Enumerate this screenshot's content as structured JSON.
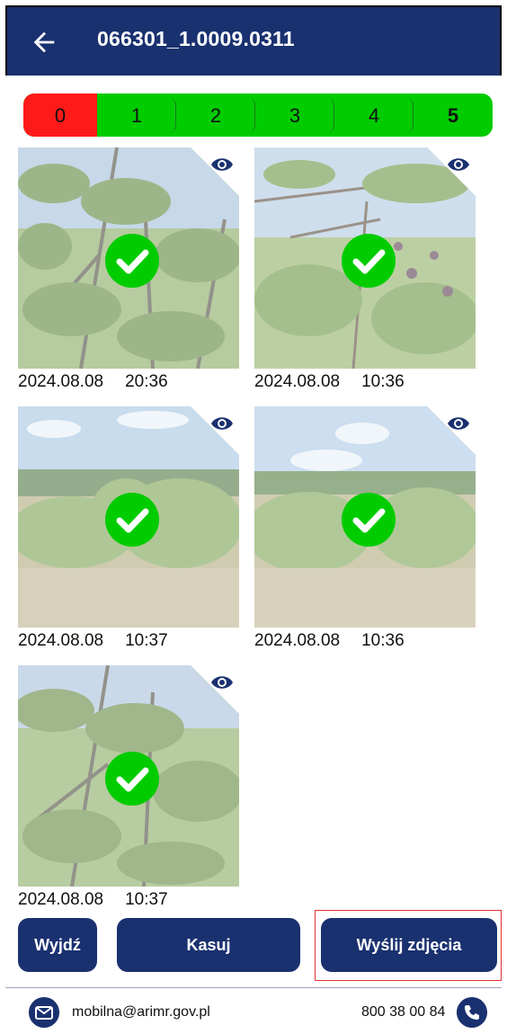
{
  "appbar": {
    "title": "066301_1.0009.0311",
    "back_icon": "arrow-left-icon"
  },
  "tabs": [
    {
      "label": "0"
    },
    {
      "label": "1"
    },
    {
      "label": "2"
    },
    {
      "label": "3"
    },
    {
      "label": "4"
    },
    {
      "label": "5"
    }
  ],
  "photos": [
    {
      "date": "2024.08.08",
      "time": "20:36",
      "status": "approved"
    },
    {
      "date": "2024.08.08",
      "time": "10:36",
      "status": "approved"
    },
    {
      "date": "2024.08.08",
      "time": "10:37",
      "status": "approved"
    },
    {
      "date": "2024.08.08",
      "time": "10:36",
      "status": "approved"
    },
    {
      "date": "2024.08.08",
      "time": "10:37",
      "status": "approved"
    }
  ],
  "buttons": {
    "exit": "Wyjdź",
    "delete": "Kasuj",
    "send": "Wyślij zdjęcia"
  },
  "footer": {
    "email": "mobilna@arimr.gov.pl",
    "phone": "800 38 00 84"
  },
  "colors": {
    "brand": "#1a3170",
    "tab_green": "#00cc00",
    "tab_red": "#ff1a1a",
    "check": "#00cc00"
  }
}
